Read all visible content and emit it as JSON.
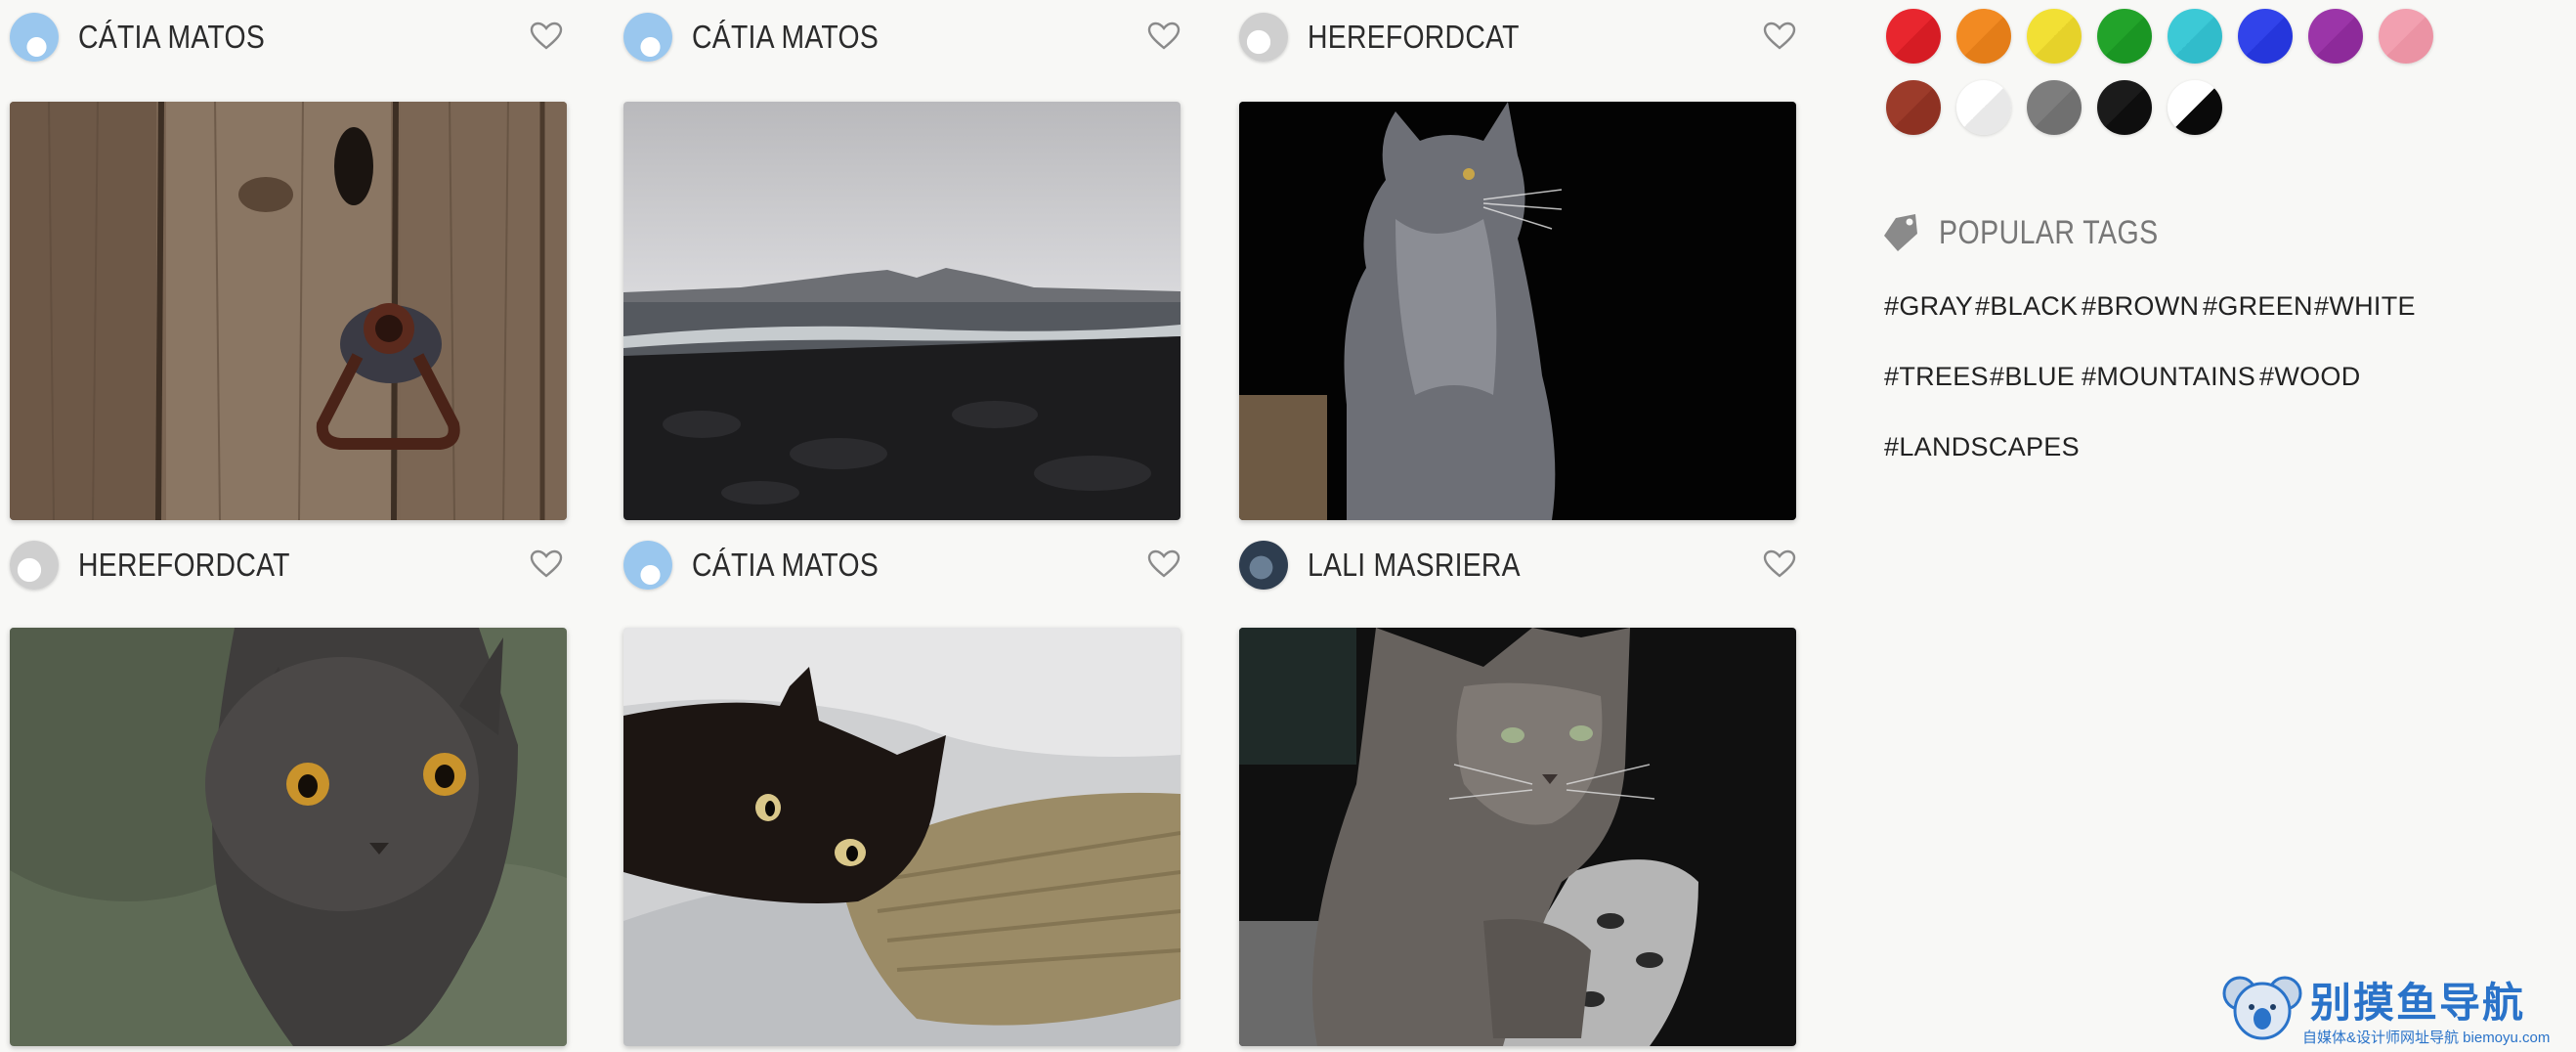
{
  "feed": {
    "cards": [
      {
        "author": "CÁTIA MATOS",
        "avatar": "blue-avatar",
        "photo": "wooden-door-photo"
      },
      {
        "author": "CÁTIA MATOS",
        "avatar": "blue-avatar",
        "photo": "coast-photo"
      },
      {
        "author": "HEREFORDCAT",
        "avatar": "gray-avatar",
        "photo": "gray-cat-photo"
      },
      {
        "author": "HEREFORDCAT",
        "avatar": "gray-avatar",
        "photo": "gray-cat-closeup-photo"
      },
      {
        "author": "CÁTIA MATOS",
        "avatar": "blue-avatar",
        "photo": "black-cat-photo"
      },
      {
        "author": "LALI MASRIERA",
        "avatar": "dark-avatar",
        "photo": "tabby-cat-photo"
      }
    ]
  },
  "colors": {
    "swatches": [
      {
        "name": "red",
        "hex": "#e8262e"
      },
      {
        "name": "orange",
        "hex": "#f28a22"
      },
      {
        "name": "yellow",
        "hex": "#f2e034"
      },
      {
        "name": "green",
        "hex": "#22a32a"
      },
      {
        "name": "cyan",
        "hex": "#3cc9d6"
      },
      {
        "name": "blue",
        "hex": "#3143ea"
      },
      {
        "name": "purple",
        "hex": "#9b35a8"
      },
      {
        "name": "pink",
        "hex": "#f2a0b0"
      },
      {
        "name": "brown",
        "hex": "#9c3b2a"
      },
      {
        "name": "white",
        "hex": "#f3f3f3"
      },
      {
        "name": "gray",
        "hex": "#7d7d7d"
      },
      {
        "name": "black",
        "hex": "#111111"
      },
      {
        "name": "black-and-white",
        "hex": "#000000"
      }
    ]
  },
  "popular_tags": {
    "title": "POPULAR TAGS",
    "rows": [
      [
        "#GRAY",
        "#BLACK",
        "#BROWN",
        "#GREEN",
        "#WHITE"
      ],
      [
        "#TREES",
        "#BLUE",
        "#MOUNTAINS",
        "#WOOD"
      ],
      [
        "#LANDSCAPES"
      ]
    ]
  },
  "watermark": {
    "title": "别摸鱼导航",
    "subtitle": "自媒体&设计师网址导航 biemoyu.com"
  }
}
